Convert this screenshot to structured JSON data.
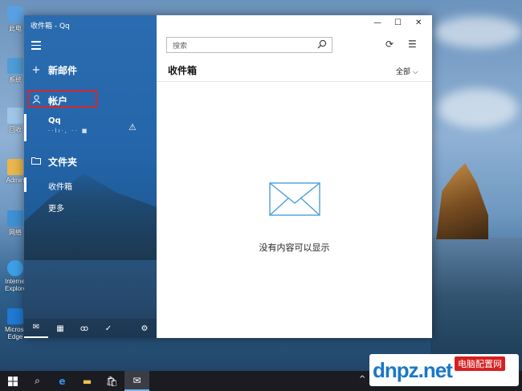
{
  "window": {
    "title": "收件箱 - Qq"
  },
  "sidebar": {
    "new_mail": "新邮件",
    "accounts": "帐户",
    "account": {
      "name": "Qq",
      "email": "··lı·,    ··  ■"
    },
    "folders": "文件夹",
    "folder_items": [
      "收件箱",
      "更多"
    ]
  },
  "main": {
    "search_placeholder": "搜索",
    "folder_title": "收件箱",
    "filter": "全部",
    "empty_message": "没有内容可以显示"
  },
  "desktop": {
    "icon_labels": [
      "此电",
      "系统",
      "回收",
      "Admin",
      "网络",
      "Internet Explorer",
      "Microsoft Edge"
    ]
  },
  "watermark": {
    "brand": "dnpz.net",
    "tag": "电脑配置网"
  },
  "colors": {
    "accent": "#2b6cb0",
    "highlight": "#d9252c"
  }
}
